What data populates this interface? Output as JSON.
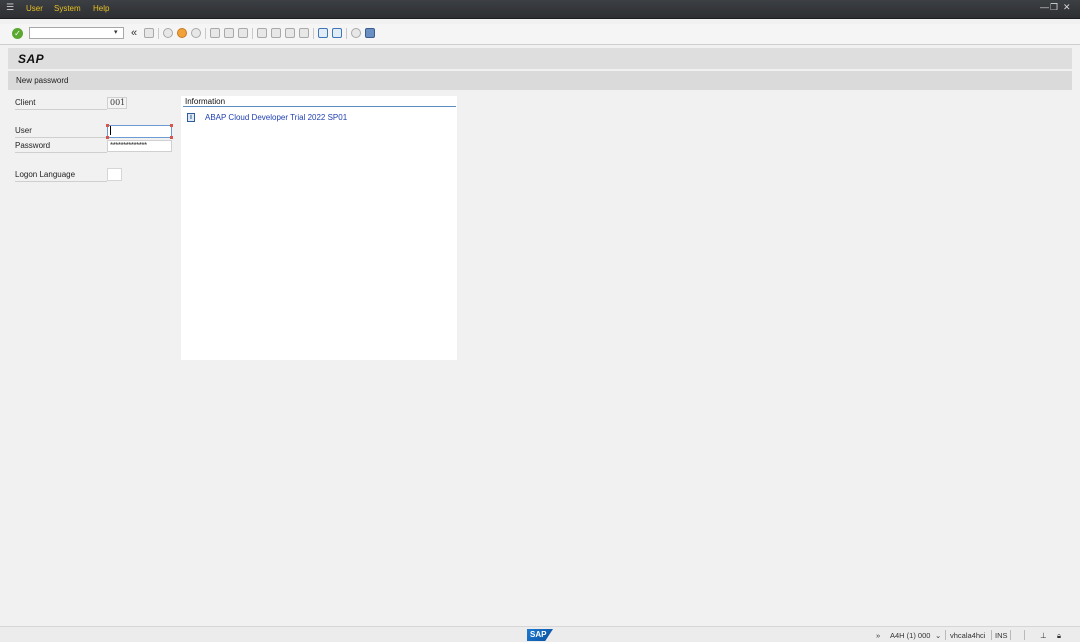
{
  "menu": {
    "items": [
      "User",
      "System",
      "Help"
    ]
  },
  "window_controls": {
    "minimize": "—",
    "restore": "❐",
    "close": "✕"
  },
  "toolbar": {
    "command_value": "",
    "back_chevron": "«"
  },
  "header": {
    "app_title": "SAP",
    "screen_title": "New password"
  },
  "logon": {
    "client_label": "Client",
    "client_value": "001",
    "user_label": "User",
    "user_value": "",
    "password_label": "Password",
    "password_value": "**************",
    "language_label": "Logon Language",
    "language_value": ""
  },
  "info": {
    "title": "Information",
    "message": "ABAP Cloud Developer Trial 2022 SP01"
  },
  "status_bar": {
    "expand": "»",
    "system": "A4H (1) 000",
    "system_dropdown": "⌄",
    "server": "vhcala4hci",
    "mode": "INS",
    "logo_text": "SAP"
  },
  "colors": {
    "menu_text": "#e8c022",
    "link_blue": "#1f3fb0",
    "ok_green": "#5aa832"
  }
}
